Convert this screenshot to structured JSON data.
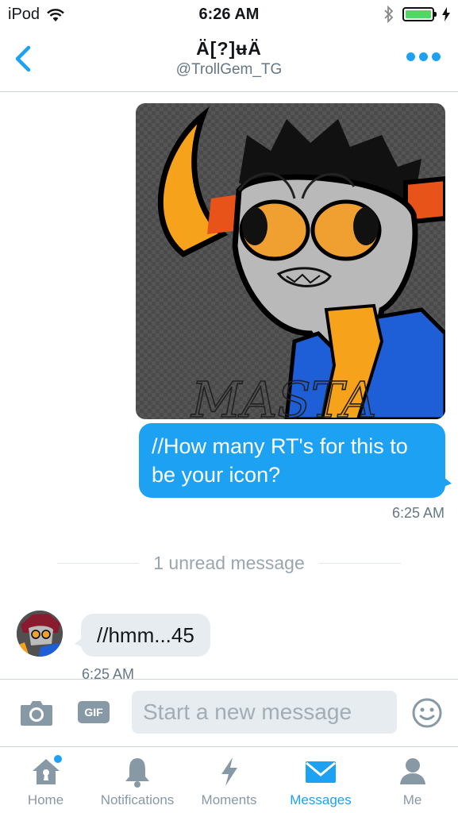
{
  "status_bar": {
    "carrier": "iPod",
    "time": "6:26 AM"
  },
  "header": {
    "title": "Ä[?]ʉÄ",
    "handle": "@TrollGem_TG"
  },
  "conversation": {
    "image_signature": "MASTA",
    "outgoing_message": "//How many RT's for this to be your icon?",
    "outgoing_time": "6:25 AM",
    "unread_divider": "1 unread message",
    "incoming_message": "//hmm...45",
    "incoming_time": "6:25 AM"
  },
  "composer": {
    "gif_label": "GIF",
    "placeholder": "Start a new message"
  },
  "tabs": [
    {
      "label": "Home",
      "icon": "home-icon",
      "has_badge": true
    },
    {
      "label": "Notifications",
      "icon": "bell-icon"
    },
    {
      "label": "Moments",
      "icon": "lightning-icon"
    },
    {
      "label": "Messages",
      "icon": "envelope-icon",
      "active": true
    },
    {
      "label": "Me",
      "icon": "person-icon"
    }
  ],
  "colors": {
    "accent": "#1da1f2",
    "inactive": "#8899a6",
    "battery": "#4cd964"
  }
}
